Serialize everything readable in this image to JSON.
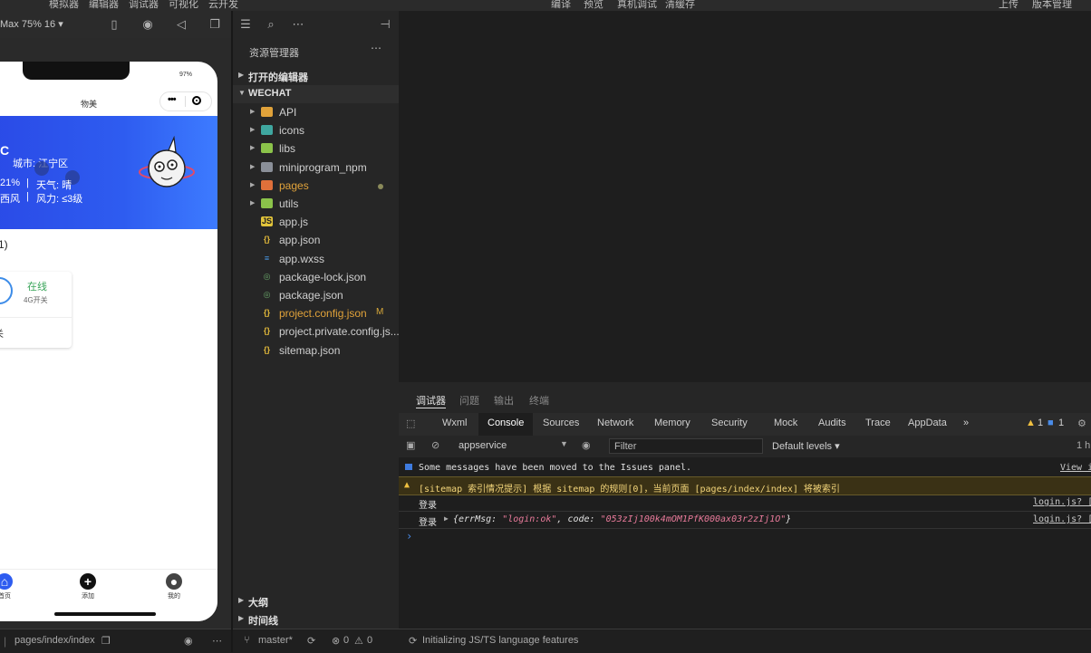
{
  "menu": [
    "模拟器",
    "编辑器",
    "调试器",
    "可视化",
    "云开发",
    "编译",
    "预览",
    "真机调试",
    "清缓存",
    "上传",
    "版本管理"
  ],
  "simulator": {
    "device_label": "Max 75% 16 ▾",
    "phone": {
      "battery": "97%",
      "nav_title": "物美",
      "banner": {
        "city": "城市: 江宁区",
        "humidity": "21%",
        "weather": "天气: 晴",
        "wind_dir": "西风",
        "wind_level": "风力: ≤3级"
      },
      "mid_text": "1)",
      "device_card": {
        "status": "在线",
        "sub": "4G开关",
        "footer": "关"
      },
      "tabbar": [
        {
          "label": "首页"
        },
        {
          "label": "添加"
        },
        {
          "label": "我的"
        }
      ]
    },
    "path": "pages/index/index"
  },
  "explorer": {
    "title": "资源管理器",
    "open_editors": "打开的编辑器",
    "project": "WECHAT",
    "files": [
      {
        "name": "API",
        "type": "folder",
        "color": "#e0a23a"
      },
      {
        "name": "icons",
        "type": "folder",
        "color": "#3fa7a0"
      },
      {
        "name": "libs",
        "type": "folder",
        "color": "#8bc34a"
      },
      {
        "name": "miniprogram_npm",
        "type": "folder",
        "color": "#8a8f98"
      },
      {
        "name": "pages",
        "type": "folder",
        "color": "#e0703a",
        "highlight": true
      },
      {
        "name": "utils",
        "type": "folder",
        "color": "#8bc34a"
      },
      {
        "name": "app.js",
        "type": "js"
      },
      {
        "name": "app.json",
        "type": "json"
      },
      {
        "name": "app.wxss",
        "type": "css"
      },
      {
        "name": "package-lock.json",
        "type": "npm"
      },
      {
        "name": "package.json",
        "type": "npm"
      },
      {
        "name": "project.config.json",
        "type": "json",
        "badge": "M",
        "highlight": true
      },
      {
        "name": "project.private.config.js...",
        "type": "json"
      },
      {
        "name": "sitemap.json",
        "type": "json"
      }
    ],
    "outline": "大纲",
    "timeline": "时间线",
    "git_branch": "master*",
    "errors": "0",
    "warnings": "0"
  },
  "devtools": {
    "top_tabs": [
      "调试器",
      "问题",
      "输出",
      "终端"
    ],
    "panels": [
      "Wxml",
      "Console",
      "Sources",
      "Network",
      "Memory",
      "Security",
      "Mock",
      "Audits",
      "Trace",
      "AppData"
    ],
    "more": "»",
    "warn_count": "1",
    "info_count": "1",
    "context": "appservice",
    "filter_placeholder": "Filter",
    "levels": "Default levels ▾",
    "hidden_count": "1 h",
    "messages": [
      {
        "kind": "info",
        "text": "Some messages have been moved to the Issues panel.",
        "source": "View i"
      },
      {
        "kind": "warning",
        "text": "[sitemap 索引情况提示] 根据 sitemap 的规则[0]，当前页面 [pages/index/index] 将被索引",
        "source": ""
      },
      {
        "kind": "log",
        "text": "登录",
        "source": "login.js? ["
      },
      {
        "kind": "log",
        "text": "登录",
        "obj_prefix": "{errMsg: ",
        "errMsg": "\"login:ok\"",
        "code_key": ", code: ",
        "code": "\"053zIj100k4mOM1PfK000ax03r2zIj1O\"",
        "obj_suffix": "}",
        "source": "login.js? ["
      }
    ],
    "prompt": "›",
    "status": "Initializing JS/TS language features"
  },
  "colors": {
    "accent": "#2e5cf0",
    "online": "#3aa55a",
    "warning_bg": "#3a3115",
    "warning_text": "#f3d57a"
  }
}
